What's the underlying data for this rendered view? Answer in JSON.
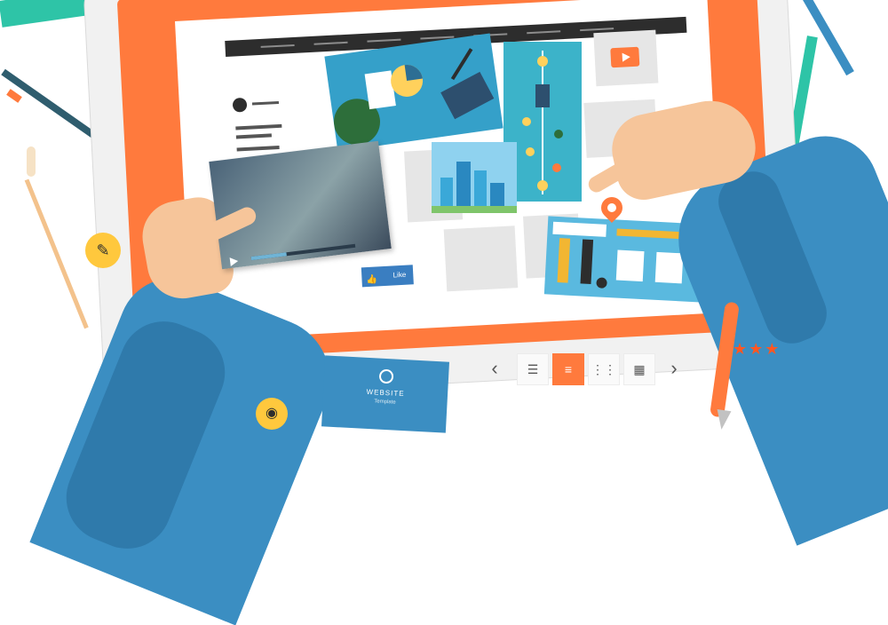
{
  "colors": {
    "accent": "#ff7a3d",
    "arm_blue": "#3b8ec2",
    "skin": "#f6c59a",
    "screen_bg": "#ffffff",
    "tile_gray": "#e6e6e6",
    "nav_dark": "#2d2d2d",
    "badge_yellow": "#ffc83d"
  },
  "screen": {
    "like_button": "Like",
    "play_icon": "play-icon"
  },
  "brand_card": {
    "name": "WEBSITE",
    "tagline": "Template"
  },
  "toolbar": {
    "prev": "‹",
    "list": "☰",
    "rows": "≡",
    "grid_small": "⋮⋮",
    "grid_large": "▦",
    "next": "›",
    "active_index": 2
  },
  "rating": {
    "stars": "★★★"
  },
  "icons": {
    "note": "✎",
    "camera": "◉",
    "thumb": "👍"
  }
}
